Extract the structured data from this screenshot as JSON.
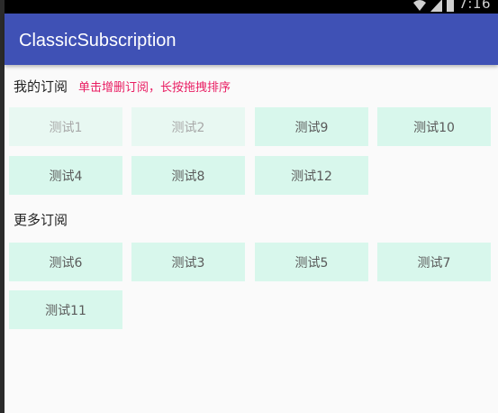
{
  "status_bar": {
    "time": "7:16",
    "icons": [
      "wifi-icon",
      "signal-icon",
      "battery-icon"
    ]
  },
  "app_bar": {
    "title": "ClassicSubscription",
    "color": "#3f51b5"
  },
  "my_subscriptions": {
    "title": "我的订阅",
    "hint": "单击增删订阅，长按拖拽排序",
    "hint_color": "#e91e63",
    "items": [
      {
        "label": "测试1",
        "fixed": true
      },
      {
        "label": "测试2",
        "fixed": true
      },
      {
        "label": "测试9",
        "fixed": false
      },
      {
        "label": "测试10",
        "fixed": false
      },
      {
        "label": "测试4",
        "fixed": false
      },
      {
        "label": "测试8",
        "fixed": false
      },
      {
        "label": "测试12",
        "fixed": false
      }
    ]
  },
  "more_subscriptions": {
    "title": "更多订阅",
    "items": [
      {
        "label": "测试6"
      },
      {
        "label": "测试3"
      },
      {
        "label": "测试5"
      },
      {
        "label": "测试7"
      },
      {
        "label": "测试11"
      }
    ]
  },
  "colors": {
    "chip_background": "#d8f7ec",
    "chip_fixed_background": "#e8f8f2",
    "page_background": "#fafafa"
  }
}
